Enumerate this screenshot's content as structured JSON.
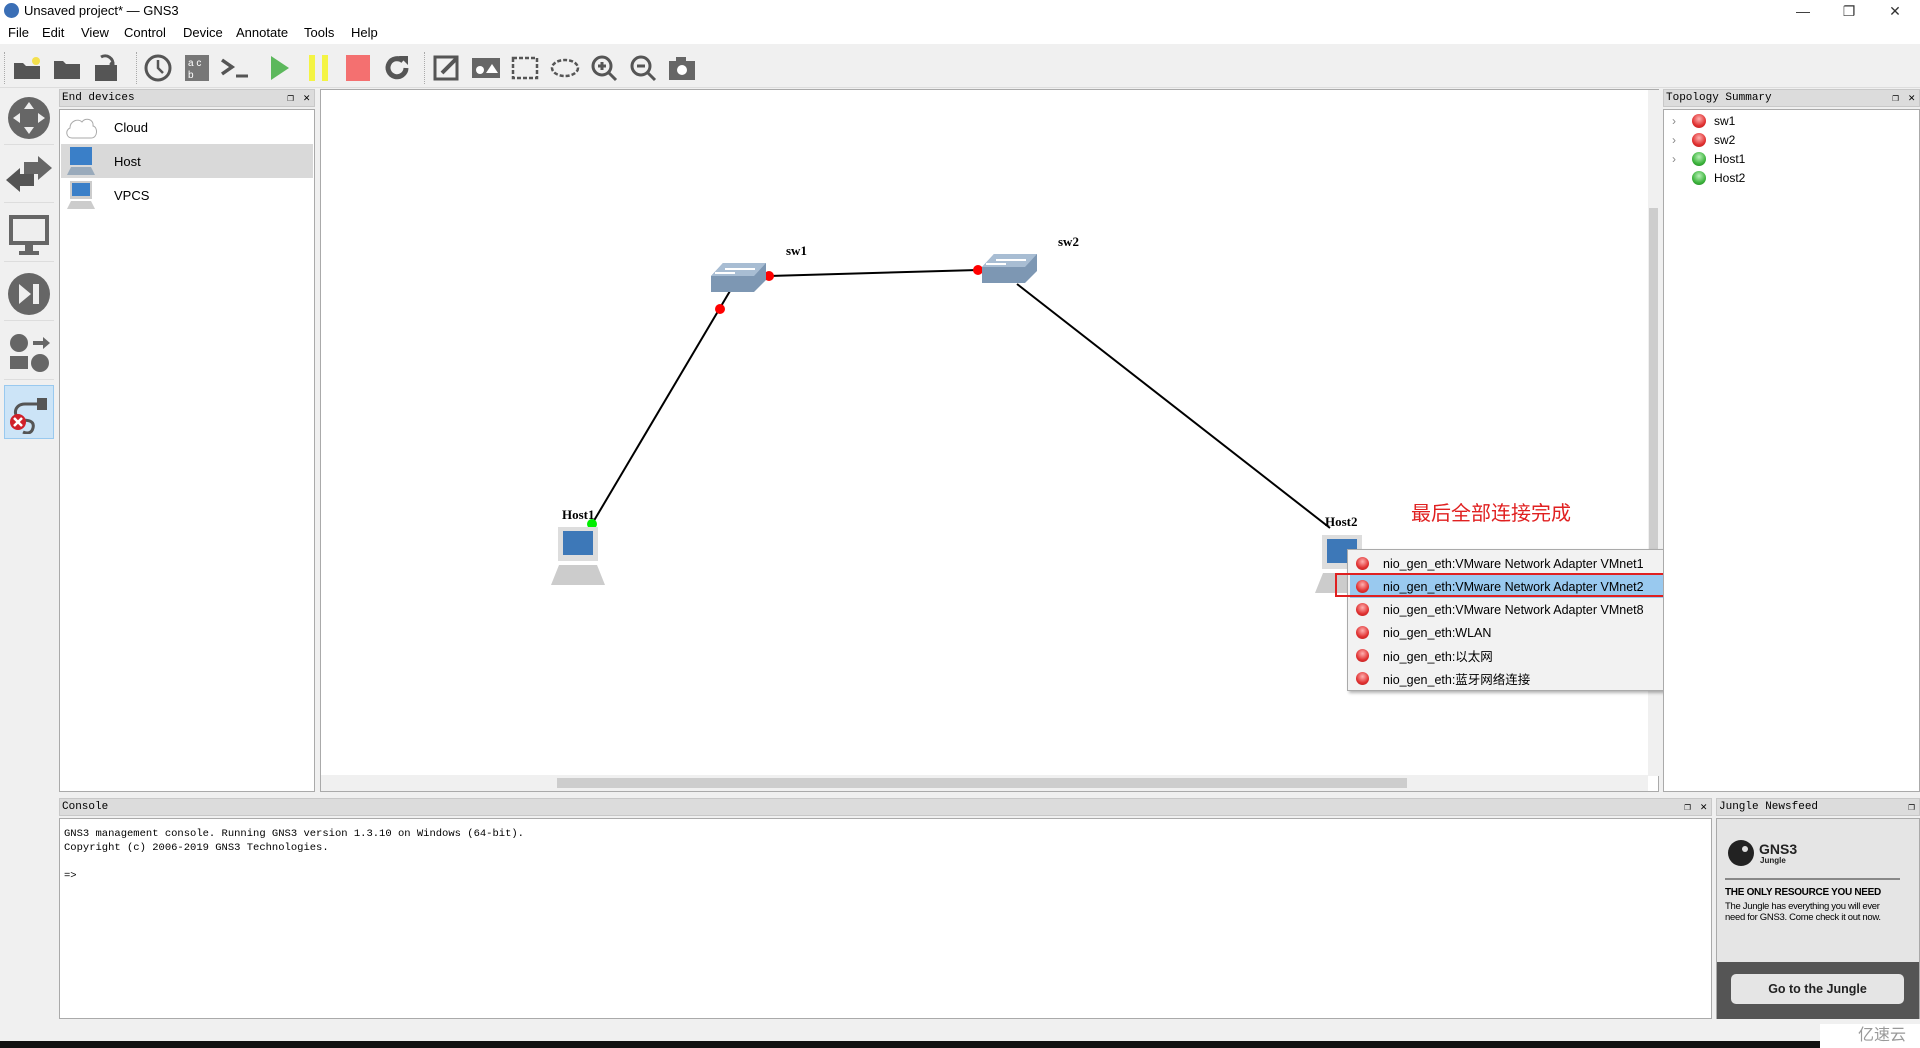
{
  "window": {
    "title": "Unsaved project* — GNS3",
    "minimize": "—",
    "restore": "❐",
    "close": "✕"
  },
  "menubar": [
    "File",
    "Edit",
    "View",
    "Control",
    "Device",
    "Annotate",
    "Tools",
    "Help"
  ],
  "toolbar": [
    "new-project",
    "open-project",
    "save-project",
    "snapshot",
    "show-interface-labels",
    "console-all",
    "start-all",
    "suspend-all",
    "stop-all",
    "reload-all",
    "add-note",
    "insert-image",
    "draw-rectangle",
    "draw-ellipse",
    "zoom-in",
    "zoom-out",
    "screenshot"
  ],
  "end_devices": {
    "title": "End devices",
    "items": [
      {
        "label": "Cloud",
        "icon": "cloud-icon"
      },
      {
        "label": "Host",
        "icon": "host-icon",
        "selected": true
      },
      {
        "label": "VPCS",
        "icon": "vpcs-icon"
      }
    ]
  },
  "topology_summary": {
    "title": "Topology Summary",
    "items": [
      {
        "label": "sw1",
        "status": "red",
        "expandable": true
      },
      {
        "label": "sw2",
        "status": "red",
        "expandable": true
      },
      {
        "label": "Host1",
        "status": "green",
        "expandable": true
      },
      {
        "label": "Host2",
        "status": "green",
        "expandable": false
      }
    ]
  },
  "canvas": {
    "nodes": [
      {
        "label": "sw1",
        "type": "switch"
      },
      {
        "label": "sw2",
        "type": "switch"
      },
      {
        "label": "Host1",
        "type": "host"
      },
      {
        "label": "Host2",
        "type": "host"
      }
    ],
    "annotation": "最后全部连接完成",
    "annotation_color": "#e02020"
  },
  "context_menu": {
    "items": [
      "nio_gen_eth:VMware Network Adapter VMnet1",
      "nio_gen_eth:VMware Network Adapter VMnet2",
      "nio_gen_eth:VMware Network Adapter VMnet8",
      "nio_gen_eth:WLAN",
      "nio_gen_eth:以太网",
      "nio_gen_eth:蓝牙网络连接"
    ],
    "selected_index": 1
  },
  "console": {
    "title": "Console",
    "lines": "GNS3 management console. Running GNS3 version 1.3.10 on Windows (64-bit).\nCopyright (c) 2006-2019 GNS3 Technologies.\n\n=>"
  },
  "jungle": {
    "title": "Jungle Newsfeed",
    "logo": "GNS3",
    "logo_sub": "Jungle",
    "headline": "THE ONLY RESOURCE YOU NEED",
    "text": "The Jungle has everything you will ever need for GNS3. Come check it out now.",
    "button": "Go to the Jungle"
  },
  "watermark": "亿速云"
}
